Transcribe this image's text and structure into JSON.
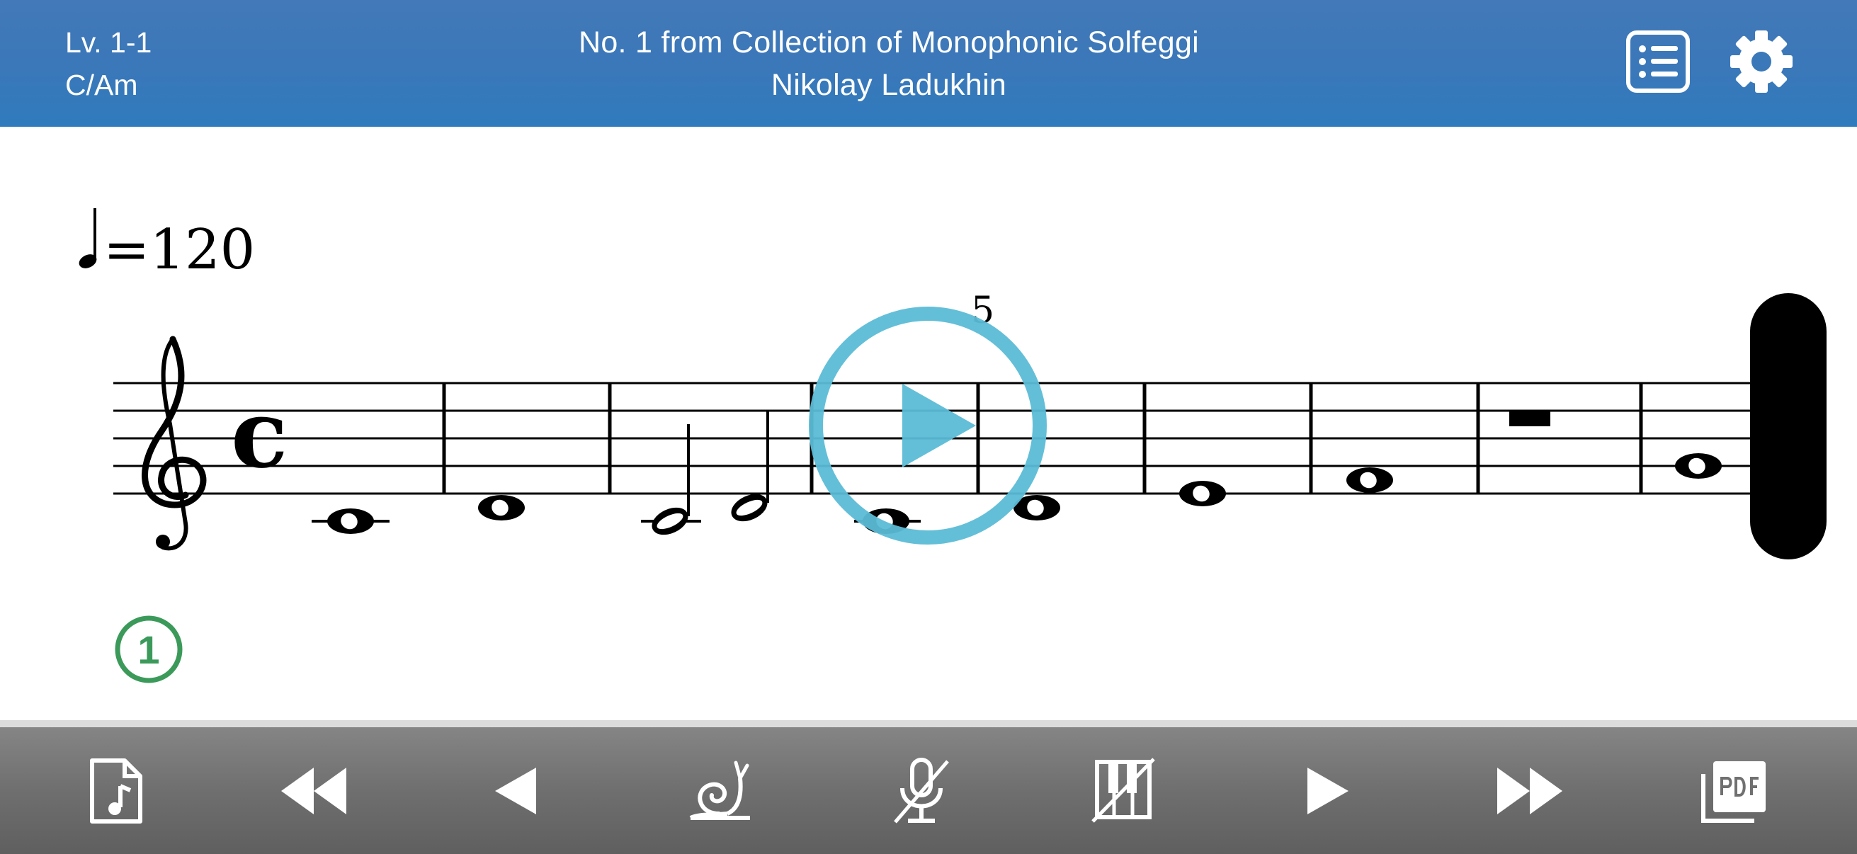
{
  "header": {
    "level": "Lv. 1-1",
    "key": "C/Am",
    "title": "No. 1 from Collection of Monophonic Solfeggi",
    "composer": "Nikolay Ladukhin",
    "buttons": [
      {
        "name": "list-menu-icon"
      },
      {
        "name": "gear-icon"
      }
    ]
  },
  "score": {
    "tempo_value": "=120",
    "time_signature": "c",
    "measure_number": "5",
    "exercise_badge": "1",
    "play_overlay_icon": "play-icon"
  },
  "toolbar": {
    "buttons": [
      {
        "name": "music-file-icon"
      },
      {
        "name": "rewind-icon"
      },
      {
        "name": "previous-icon"
      },
      {
        "name": "snail-slow-icon"
      },
      {
        "name": "microphone-off-icon"
      },
      {
        "name": "piano-off-icon"
      },
      {
        "name": "next-icon"
      },
      {
        "name": "fast-forward-icon"
      },
      {
        "name": "pdf-export-icon"
      }
    ]
  },
  "colors": {
    "header": "#3b79b9",
    "play_overlay": "#5bbcd6",
    "badge": "#3b9a5a",
    "toolbar": "#707070"
  }
}
